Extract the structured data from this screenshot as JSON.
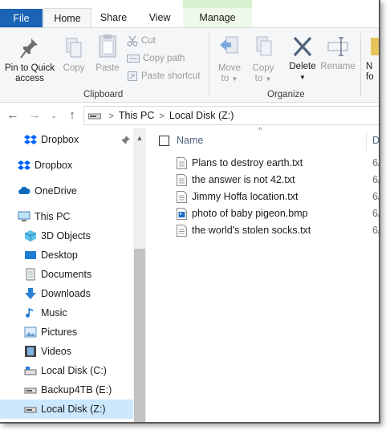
{
  "tabs": {
    "file": "File",
    "home": "Home",
    "share": "Share",
    "view": "View",
    "manage": "Manage"
  },
  "ribbon": {
    "pin_line1": "Pin to Quick",
    "pin_line2": "access",
    "copy": "Copy",
    "paste": "Paste",
    "cut": "Cut",
    "copy_path": "Copy path",
    "paste_shortcut": "Paste shortcut",
    "clipboard_group": "Clipboard",
    "move_to_line1": "Move",
    "move_to_line2": "to",
    "copy_to_line1": "Copy",
    "copy_to_line2": "to",
    "delete": "Delete",
    "rename": "Rename",
    "organize_group": "Organize",
    "new_line1": "N",
    "new_line2": "fo"
  },
  "address": {
    "crumb1": "This PC",
    "crumb2": "Local Disk (Z:)"
  },
  "nav": {
    "items": [
      {
        "label": "Dropbox",
        "icon": "dropbox-icon"
      },
      {
        "label": "Dropbox",
        "icon": "dropbox-icon"
      },
      {
        "label": "OneDrive",
        "icon": "cloud-icon"
      },
      {
        "label": "This PC",
        "icon": "computer-icon"
      },
      {
        "label": "3D Objects",
        "icon": "cube-icon"
      },
      {
        "label": "Desktop",
        "icon": "desktop-icon"
      },
      {
        "label": "Documents",
        "icon": "document-icon"
      },
      {
        "label": "Downloads",
        "icon": "download-icon"
      },
      {
        "label": "Music",
        "icon": "music-icon"
      },
      {
        "label": "Pictures",
        "icon": "picture-icon"
      },
      {
        "label": "Videos",
        "icon": "film-icon"
      },
      {
        "label": "Local Disk (C:)",
        "icon": "drive-icon"
      },
      {
        "label": "Backup4TB (E:)",
        "icon": "drive-icon"
      },
      {
        "label": "Local Disk (Z:)",
        "icon": "drive-icon"
      }
    ]
  },
  "files": {
    "column_name": "Name",
    "column_date": "D",
    "rows": [
      {
        "name": "Plans to destroy earth.txt",
        "date": "6/",
        "icon": "text-file-icon"
      },
      {
        "name": "the answer is not 42.txt",
        "date": "6/",
        "icon": "text-file-icon"
      },
      {
        "name": "Jimmy Hoffa location.txt",
        "date": "6/",
        "icon": "text-file-icon"
      },
      {
        "name": "photo of baby pigeon.bmp",
        "date": "6/",
        "icon": "image-file-icon"
      },
      {
        "name": "the world's stolen socks.txt",
        "date": "6/",
        "icon": "text-file-icon"
      }
    ]
  },
  "colors": {
    "file_tab": "#1a63b5",
    "selection": "#cce8ff",
    "manage_band": "#d7f2cf"
  }
}
